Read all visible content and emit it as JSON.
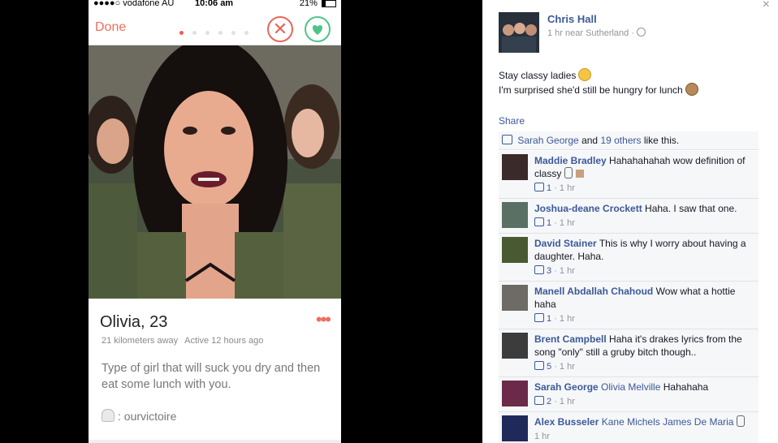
{
  "status_bar": {
    "carrier": "●●●●○ vodafone AU",
    "time": "10:06 am",
    "battery": "21%"
  },
  "nav": {
    "done": "Done",
    "pager_dots": 6,
    "pager_active": 0,
    "colors": {
      "accent": "#ec6f5d",
      "like": "#4ec488"
    }
  },
  "profile": {
    "name_age": "Olivia, 23",
    "more": "•••",
    "distance": "21 kilometers away",
    "active": "Active 12 hours ago",
    "bio": "Type of girl that will suck you dry and then eat some lunch with you.",
    "snapchat": ": ourvictoire"
  },
  "post": {
    "close": "×",
    "author": "Chris Hall",
    "time": "1 hr near Sutherland ·",
    "line1": "Stay classy ladies",
    "line2": "I'm surprised she'd still be hungry for lunch",
    "share": "Share",
    "likes": {
      "first": "Sarah George",
      "and": "and",
      "others": "19 others",
      "tail": "like this."
    }
  },
  "comments": [
    {
      "name": "Maddie Bradley",
      "tag": "",
      "text": "Hahahahahah wow definition of classy",
      "likes": "1",
      "time": "· 1 hr"
    },
    {
      "name": "Joshua-deane Crockett",
      "tag": "",
      "text": "Haha. I saw that one.",
      "likes": "1",
      "time": "· 1 hr"
    },
    {
      "name": "David Stainer",
      "tag": "",
      "text": "This is why I worry about having a daughter. Haha.",
      "likes": "3",
      "time": "· 1 hr"
    },
    {
      "name": "Manell Abdallah Chahoud",
      "tag": "",
      "text": "Wow what a hottie haha",
      "likes": "1",
      "time": "· 1 hr"
    },
    {
      "name": "Brent Campbell",
      "tag": "",
      "text": "Haha it's drakes lyrics from the song \"only\" still a gruby bitch though..",
      "likes": "5",
      "time": "· 1 hr"
    },
    {
      "name": "Sarah George",
      "tag": "Olivia Melville",
      "text": "Hahahaha",
      "likes": "2",
      "time": "· 1 hr"
    },
    {
      "name": "Alex Busseler",
      "tag": "Kane Michels James De Maria",
      "text": "",
      "likes": "",
      "time": "1 hr"
    }
  ]
}
